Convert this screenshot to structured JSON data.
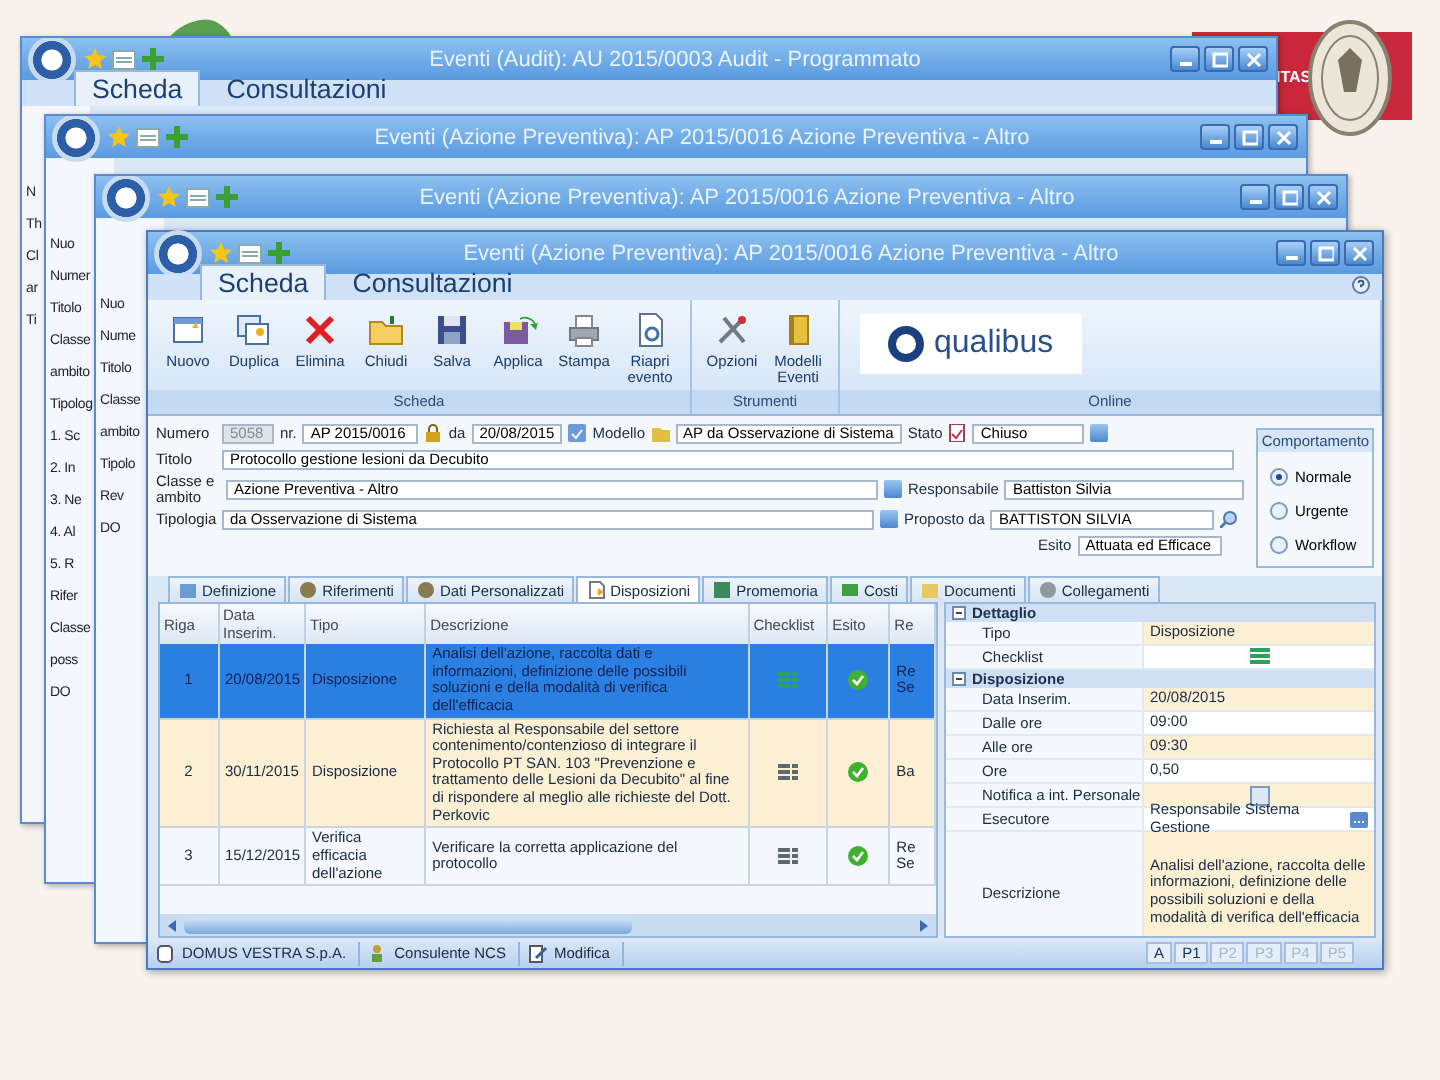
{
  "brand": {
    "text": "ITAS"
  },
  "back_windows": [
    {
      "title": "Eventi (Audit): AU 2015/0003 Audit - Programmato",
      "tabs": [
        {
          "label": "Scheda",
          "selected": true
        },
        {
          "label": "Consultazioni",
          "selected": false
        }
      ],
      "strip": [
        "N",
        "Th",
        "Cl",
        "ar",
        "Ti"
      ]
    },
    {
      "title": "Eventi (Azione Preventiva): AP 2015/0016 Azione Preventiva - Altro",
      "strip": [
        "Nuo",
        "Numer",
        "Titolo",
        "Classe",
        "ambito",
        "Tipolog",
        "1. Sc",
        "2. In",
        "3. Ne",
        "4. Al",
        "5. R",
        "Rifer",
        "Classe",
        "poss",
        "DO"
      ]
    },
    {
      "title": "Eventi (Azione Preventiva): AP 2015/0016 Azione Preventiva - Altro",
      "strip": [
        "Nuo",
        "Nume",
        "Titolo",
        "Classe",
        "ambito",
        "Tipolo",
        "Rev",
        "DO"
      ]
    }
  ],
  "window": {
    "title": "Eventi (Azione Preventiva): AP 2015/0016 Azione Preventiva - Altro",
    "tabs": [
      {
        "label": "Scheda",
        "selected": true
      },
      {
        "label": "Consultazioni",
        "selected": false
      }
    ],
    "ribbon": [
      {
        "label": "Scheda",
        "buttons": [
          {
            "label": "Nuovo",
            "kind": "new"
          },
          {
            "label": "Duplica",
            "kind": "copy"
          },
          {
            "label": "Elimina",
            "kind": "delete"
          },
          {
            "label": "Chiudi",
            "kind": "folder"
          },
          {
            "label": "Salva",
            "kind": "save"
          },
          {
            "label": "Applica",
            "kind": "apply"
          },
          {
            "label": "Stampa",
            "kind": "print"
          },
          {
            "label": "Riapri evento",
            "kind": "reopen"
          }
        ]
      },
      {
        "label": "Strumenti",
        "buttons": [
          {
            "label": "Opzioni",
            "kind": "tools"
          },
          {
            "label": "Modelli Eventi",
            "kind": "book"
          }
        ]
      },
      {
        "label": "Online",
        "logo": "qualibus"
      }
    ],
    "form": {
      "numero_label": "Numero",
      "numero": "5058",
      "nr_label": "nr.",
      "nr": "AP 2015/0016",
      "da_label": "da",
      "date": "20/08/2015",
      "modello_label": "Modello",
      "modello": "AP da Osservazione di Sistema",
      "stato_label": "Stato",
      "stato": "Chiuso",
      "titolo_label": "Titolo",
      "titolo": "Protocollo gestione lesioni da Decubito",
      "classe_label": "Classe e ambito",
      "classe": "Azione Preventiva - Altro",
      "responsabile_label": "Responsabile",
      "responsabile": "Battiston Silvia",
      "tipologia_label": "Tipologia",
      "tipologia": "da Osservazione di Sistema",
      "proposto_label": "Proposto da",
      "proposto": "BATTISTON SILVIA",
      "esito_label": "Esito",
      "esito": "Attuata ed Efficace"
    },
    "behaviour": {
      "title": "Comportamento",
      "options": [
        {
          "label": "Normale",
          "selected": true
        },
        {
          "label": "Urgente",
          "selected": false
        },
        {
          "label": "Workflow",
          "selected": false
        }
      ]
    },
    "doc_tabs": [
      {
        "label": "Definizione",
        "selected": false
      },
      {
        "label": "Riferimenti",
        "selected": false
      },
      {
        "label": "Dati Personalizzati",
        "selected": false
      },
      {
        "label": "Disposizioni",
        "selected": true
      },
      {
        "label": "Promemoria",
        "selected": false
      },
      {
        "label": "Costi",
        "selected": false
      },
      {
        "label": "Documenti",
        "selected": false
      },
      {
        "label": "Collegamenti",
        "selected": false
      }
    ],
    "table": {
      "columns": [
        "Riga",
        "Data Inserim.",
        "Tipo",
        "Descrizione",
        "Checklist",
        "Esito",
        "Re"
      ],
      "rows": [
        {
          "cells": [
            "1",
            "20/08/2015",
            "Disposizione",
            "Analisi dell'azione, raccolta dati e informazioni, definizione delle possibili soluzioni e della modalità di verifica dell'efficacia",
            "",
            "",
            "Re Se"
          ],
          "selected": true,
          "checklist_filled": true
        },
        {
          "cells": [
            "2",
            "30/11/2015",
            "Disposizione",
            "Richiesta al Responsabile del settore contenimento/contenzioso di integrare il Protocollo PT SAN. 103 \"Prevenzione e trattamento delle Lesioni da Decubito\" al fine di rispondere al meglio alle richieste del Dott. Perkovic",
            "",
            "",
            "Ba"
          ],
          "selected": false,
          "checklist_filled": false
        },
        {
          "cells": [
            "3",
            "15/12/2015",
            "Verifica efficacia dell'azione",
            "Verificare la corretta applicazione del protocollo",
            "",
            "",
            "Re Se"
          ],
          "selected": false,
          "checklist_filled": false
        }
      ]
    },
    "properties": [
      {
        "section": "Dettaglio",
        "items": [
          {
            "kind": "text",
            "label": "Tipo",
            "value": "Disposizione"
          },
          {
            "kind": "icon",
            "label": "Checklist"
          }
        ]
      },
      {
        "section": "Disposizione",
        "items": [
          {
            "kind": "text",
            "label": "Data Inserim.",
            "value": "20/08/2015"
          },
          {
            "kind": "text",
            "label": "Dalle ore",
            "value": "09:00"
          },
          {
            "kind": "text",
            "label": "Alle ore",
            "value": "09:30"
          },
          {
            "kind": "text",
            "label": "Ore",
            "value": "0,50"
          },
          {
            "kind": "check",
            "label": "Notifica a int. Personale",
            "checked": false
          },
          {
            "kind": "text",
            "label": "Esecutore",
            "value": "Responsabile Sistema Gestione"
          },
          {
            "kind": "text",
            "label": "Descrizione",
            "value": "Analisi dell'azione, raccolta delle informazioni, definizione delle possibili soluzioni e della modalità di verifica dell'efficacia"
          }
        ]
      }
    ],
    "status_bar": {
      "items": [
        "DOMUS VESTRA S.p.A.",
        "Consulente NCS",
        "Modifica"
      ],
      "pages": [
        {
          "label": "A",
          "disabled": false
        },
        {
          "label": "P1",
          "disabled": false
        },
        {
          "label": "P2",
          "disabled": true
        },
        {
          "label": "P3",
          "disabled": true
        },
        {
          "label": "P4",
          "disabled": true
        },
        {
          "label": "P5",
          "disabled": true
        }
      ]
    }
  }
}
